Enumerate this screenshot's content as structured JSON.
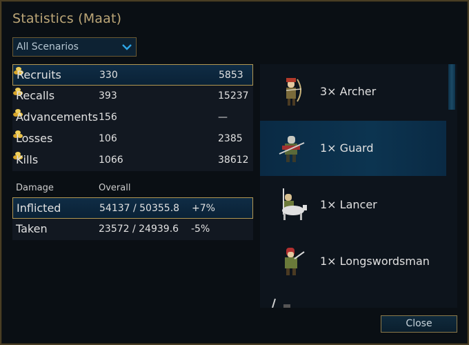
{
  "title": "Statistics (Maat)",
  "scenario_select": {
    "value": "All Scenarios"
  },
  "stats": [
    {
      "label": "Recruits",
      "count": "330",
      "gold": "5853",
      "selected": true
    },
    {
      "label": "Recalls",
      "count": "393",
      "gold": "15237"
    },
    {
      "label": "Advancements",
      "count": "156",
      "gold": "—"
    },
    {
      "label": "Losses",
      "count": "106",
      "gold": "2385"
    },
    {
      "label": "Kills",
      "count": "1066",
      "gold": "38612"
    }
  ],
  "damage": {
    "header_label": "Damage",
    "header_overall": "Overall",
    "rows": [
      {
        "label": "Inflicted",
        "value": "54137 / 50355.8",
        "pct": "+7%",
        "selected": true
      },
      {
        "label": "Taken",
        "value": "23572 / 24939.6",
        "pct": "-5%"
      }
    ]
  },
  "units": [
    {
      "label": "3× Archer",
      "icon": "archer-icon"
    },
    {
      "label": "1× Guard",
      "icon": "guard-icon",
      "selected": true
    },
    {
      "label": "1× Lancer",
      "icon": "lancer-icon"
    },
    {
      "label": "1× Longswordsman",
      "icon": "longswordsman-icon"
    }
  ],
  "close_label": "Close",
  "colors": {
    "accent_gold": "#bca677",
    "selection_border": "#b39852",
    "selection_bg": "#0f2c45"
  }
}
